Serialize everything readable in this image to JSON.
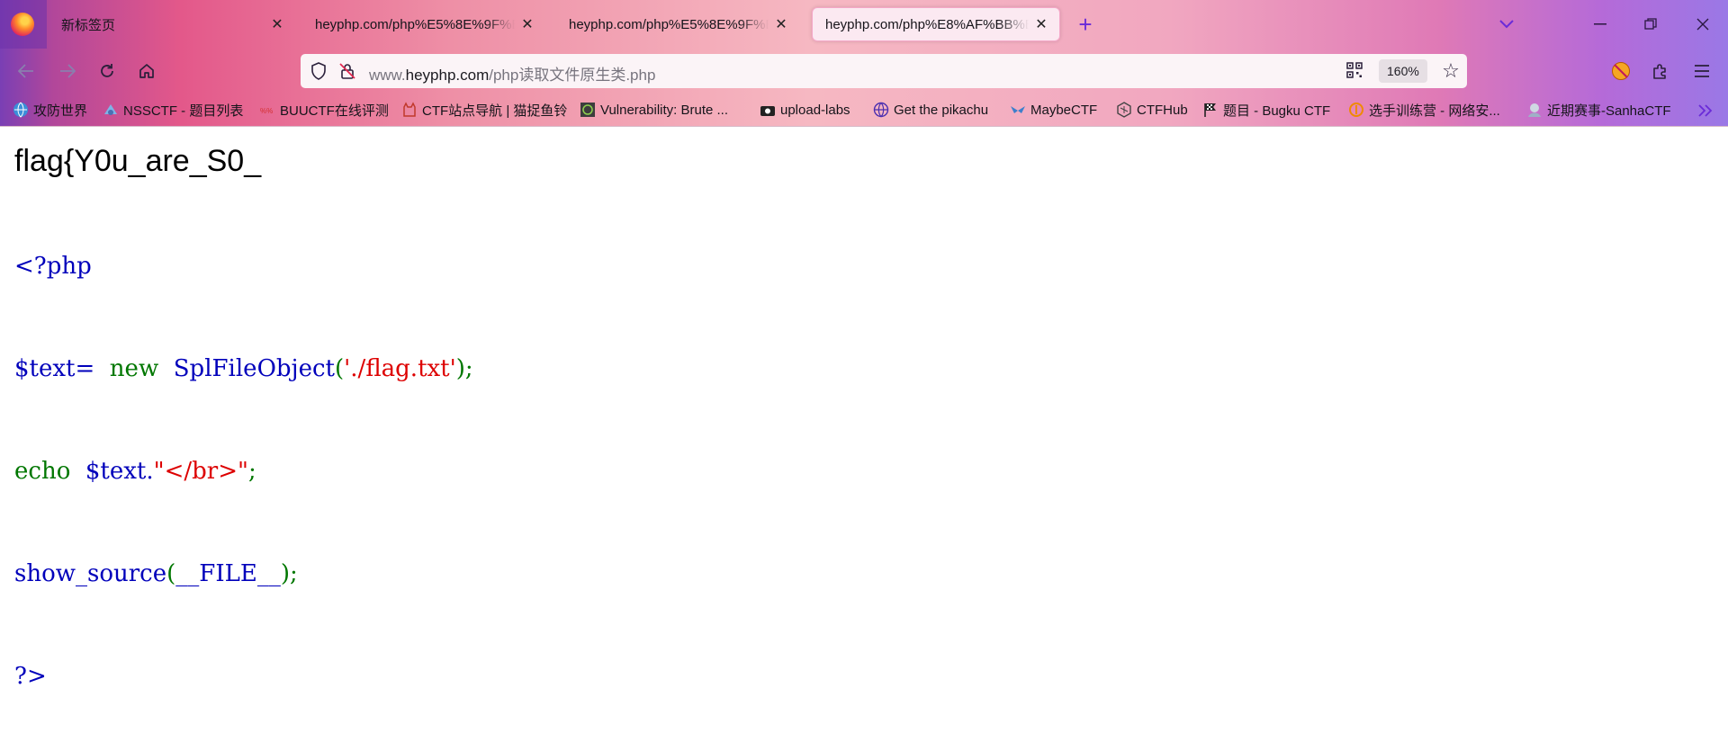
{
  "browser": {
    "tabs": [
      {
        "label": "新标签页",
        "active": false
      },
      {
        "label": "heyphp.com/php%E5%8E%9F%E5",
        "active": false
      },
      {
        "label": "heyphp.com/php%E5%8E%9F%E5",
        "active": false
      },
      {
        "label": "heyphp.com/php%E8%AF%BB%E",
        "active": true
      }
    ],
    "new_tab_symbol": "+",
    "url_bar": {
      "prefix": "www.",
      "domain": "heyphp.com",
      "path": "/php读取文件原生类.php",
      "zoom": "160%"
    },
    "bookmarks": [
      {
        "label": "攻防世界",
        "icon": "globe-blue-icon"
      },
      {
        "label": "NSSCTF - 题目列表",
        "icon": "nssctf-icon"
      },
      {
        "label": "BUUCTF在线评测",
        "icon": "buu-icon"
      },
      {
        "label": "CTF站点导航 | 猫捉鱼铃",
        "icon": "cat-icon"
      },
      {
        "label": "Vulnerability: Brute ...",
        "icon": "dvwa-icon"
      },
      {
        "label": "upload-labs",
        "icon": "upload-icon"
      },
      {
        "label": "Get the pikachu",
        "icon": "globe-icon"
      },
      {
        "label": "MaybeCTF",
        "icon": "maybe-icon"
      },
      {
        "label": "CTFHub",
        "icon": "ctfhub-icon"
      },
      {
        "label": "题目 - Bugku CTF",
        "icon": "flag-icon"
      },
      {
        "label": "选手训练营 - 网络安...",
        "icon": "training-icon"
      },
      {
        "label": "近期赛事-SanhaCTF",
        "icon": "sanha-icon"
      }
    ]
  },
  "page": {
    "flag_text": "flag{Y0u_are_S0_",
    "code": {
      "l1_open": "<?php",
      "l2_var": "$text=",
      "l2_new": "  new  ",
      "l2_class": "SplFileObject",
      "l2_paren_open": "(",
      "l2_string": "'./flag.txt'",
      "l2_paren_close": ");",
      "l3_echo": "echo  ",
      "l3_var": "$text.",
      "l3_string": "\"</br>\"",
      "l3_semi": ";",
      "l4_fn": "show_source",
      "l4_paren_open": "(",
      "l4_const": "__FILE__",
      "l4_paren_close": ");",
      "l5_close": "?>"
    },
    "colors": {
      "default": "#0000bb",
      "keyword": "#007700",
      "string": "#dd0000"
    }
  }
}
